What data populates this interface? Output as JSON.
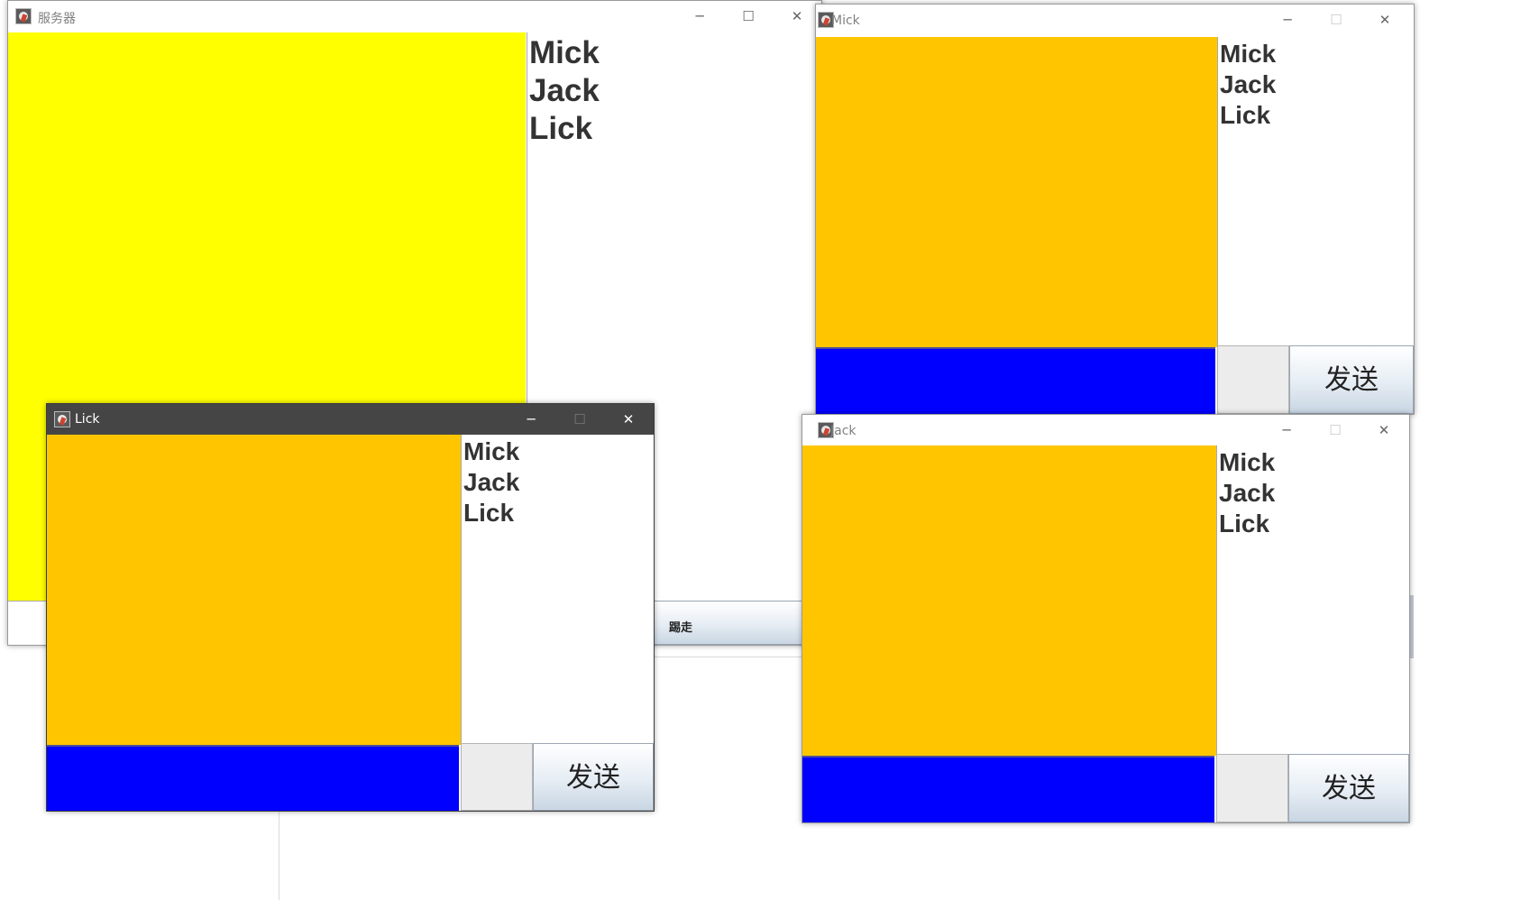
{
  "colors": {
    "server_panel": "#ffff00",
    "client_panel": "#ffc600",
    "input_bar": "#0000ff",
    "name_text": "#333333"
  },
  "icons": {
    "app": "java-duke-icon",
    "minimize": "minimize-icon",
    "maximize": "maximize-icon",
    "close": "close-icon"
  },
  "controls": {
    "minimize": "─",
    "maximize": "☐",
    "close": "✕"
  },
  "server": {
    "title": "服务器",
    "users": [
      "Mick",
      "Jack",
      "Lick"
    ],
    "kick_label": "踢走"
  },
  "mick": {
    "title": "Mick",
    "users": [
      "Mick",
      "Jack",
      "Lick"
    ],
    "send_label": "发送"
  },
  "jack": {
    "title": "Jack",
    "users": [
      "Mick",
      "Jack",
      "Lick"
    ],
    "send_label": "发送"
  },
  "lick": {
    "title": "Lick",
    "users": [
      "Mick",
      "Jack",
      "Lick"
    ],
    "send_label": "发送"
  }
}
